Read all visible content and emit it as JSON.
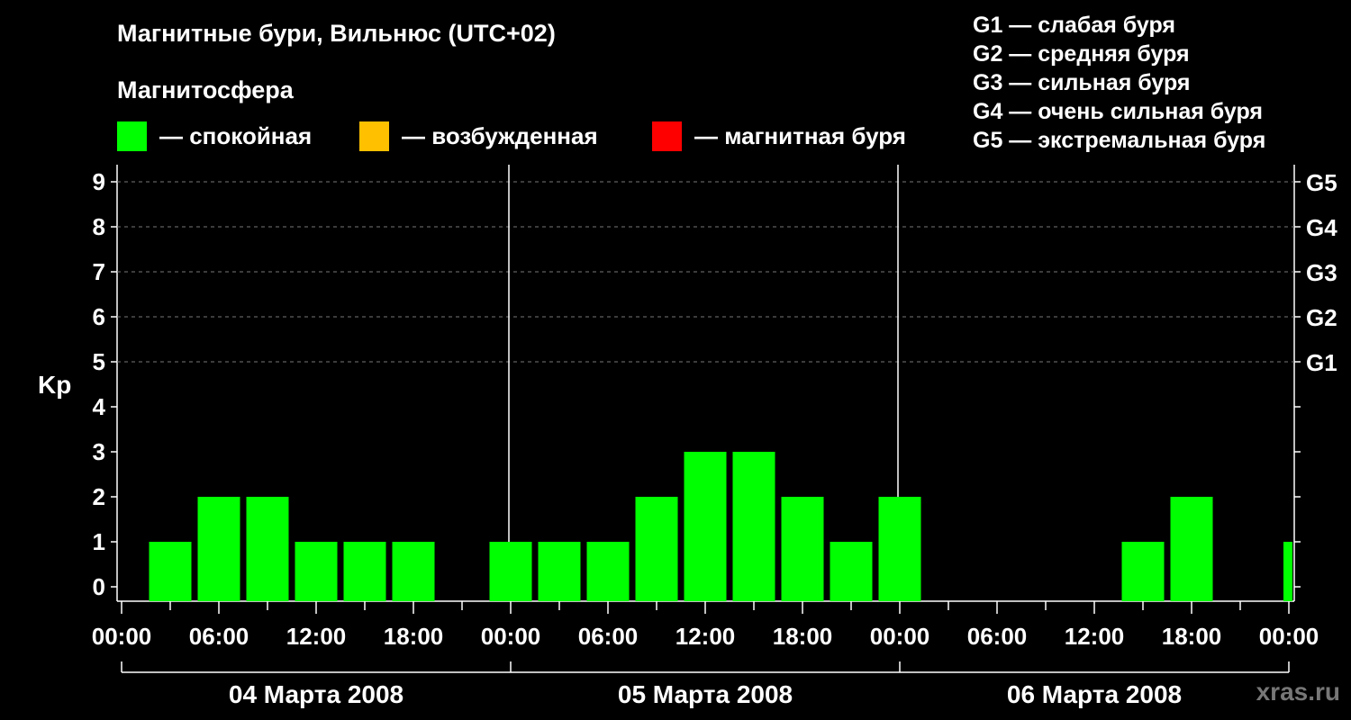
{
  "header": {
    "title": "Магнитные бури, Вильнюс (UTC+02)",
    "subtitle": "Магнитосфера"
  },
  "legend": [
    {
      "label": "— спокойная",
      "color": "#00ff00"
    },
    {
      "label": "— возбужденная",
      "color": "#ffc000"
    },
    {
      "label": "— магнитная буря",
      "color": "#ff0000"
    }
  ],
  "g_scale": [
    "G1 — слабая буря",
    "G2 — средняя буря",
    "G3 — сильная буря",
    "G4 — очень сильная буря",
    "G5 — экстремальная буря"
  ],
  "watermark": "xras.ru",
  "chart_data": {
    "type": "bar",
    "ylabel": "Kp",
    "ylim": [
      0,
      9
    ],
    "y_ticks": [
      "0",
      "1",
      "2",
      "3",
      "4",
      "5",
      "6",
      "7",
      "8",
      "9"
    ],
    "right_ticks": [
      {
        "value": 5,
        "label": "G1"
      },
      {
        "value": 6,
        "label": "G2"
      },
      {
        "value": 7,
        "label": "G3"
      },
      {
        "value": 8,
        "label": "G4"
      },
      {
        "value": 9,
        "label": "G5"
      }
    ],
    "x_tick_labels": [
      "00:00",
      "06:00",
      "12:00",
      "18:00",
      "00:00",
      "06:00",
      "12:00",
      "18:00",
      "00:00",
      "06:00",
      "12:00",
      "18:00",
      "00:00"
    ],
    "days": [
      "04 Марта 2008",
      "05 Марта 2008",
      "06 Марта 2008"
    ],
    "grid": "dashed at Kp 5-9",
    "bar_color": "#00ff00",
    "bars": [
      {
        "time": "04 Марта 2008 03:00",
        "value": 1
      },
      {
        "time": "04 Марта 2008 06:00",
        "value": 2
      },
      {
        "time": "04 Марта 2008 09:00",
        "value": 2
      },
      {
        "time": "04 Марта 2008 12:00",
        "value": 1
      },
      {
        "time": "04 Марта 2008 15:00",
        "value": 1
      },
      {
        "time": "04 Марта 2008 18:00",
        "value": 1
      },
      {
        "time": "04 Марта 2008 21:00",
        "value": 0
      },
      {
        "time": "05 Марта 2008 00:00",
        "value": 1
      },
      {
        "time": "05 Марта 2008 03:00",
        "value": 1
      },
      {
        "time": "05 Марта 2008 06:00",
        "value": 1
      },
      {
        "time": "05 Марта 2008 09:00",
        "value": 2
      },
      {
        "time": "05 Марта 2008 12:00",
        "value": 3
      },
      {
        "time": "05 Марта 2008 15:00",
        "value": 3
      },
      {
        "time": "05 Марта 2008 18:00",
        "value": 2
      },
      {
        "time": "05 Марта 2008 21:00",
        "value": 1
      },
      {
        "time": "06 Марта 2008 00:00",
        "value": 2
      },
      {
        "time": "06 Марта 2008 03:00",
        "value": 0
      },
      {
        "time": "06 Марта 2008 06:00",
        "value": 0
      },
      {
        "time": "06 Марта 2008 09:00",
        "value": 0
      },
      {
        "time": "06 Марта 2008 12:00",
        "value": 0
      },
      {
        "time": "06 Марта 2008 15:00",
        "value": 1
      },
      {
        "time": "06 Марта 2008 18:00",
        "value": 2
      },
      {
        "time": "06 Марта 2008 21:00",
        "value": 0
      },
      {
        "time": "07 Марта 2008 00:00",
        "value": 1
      }
    ]
  }
}
